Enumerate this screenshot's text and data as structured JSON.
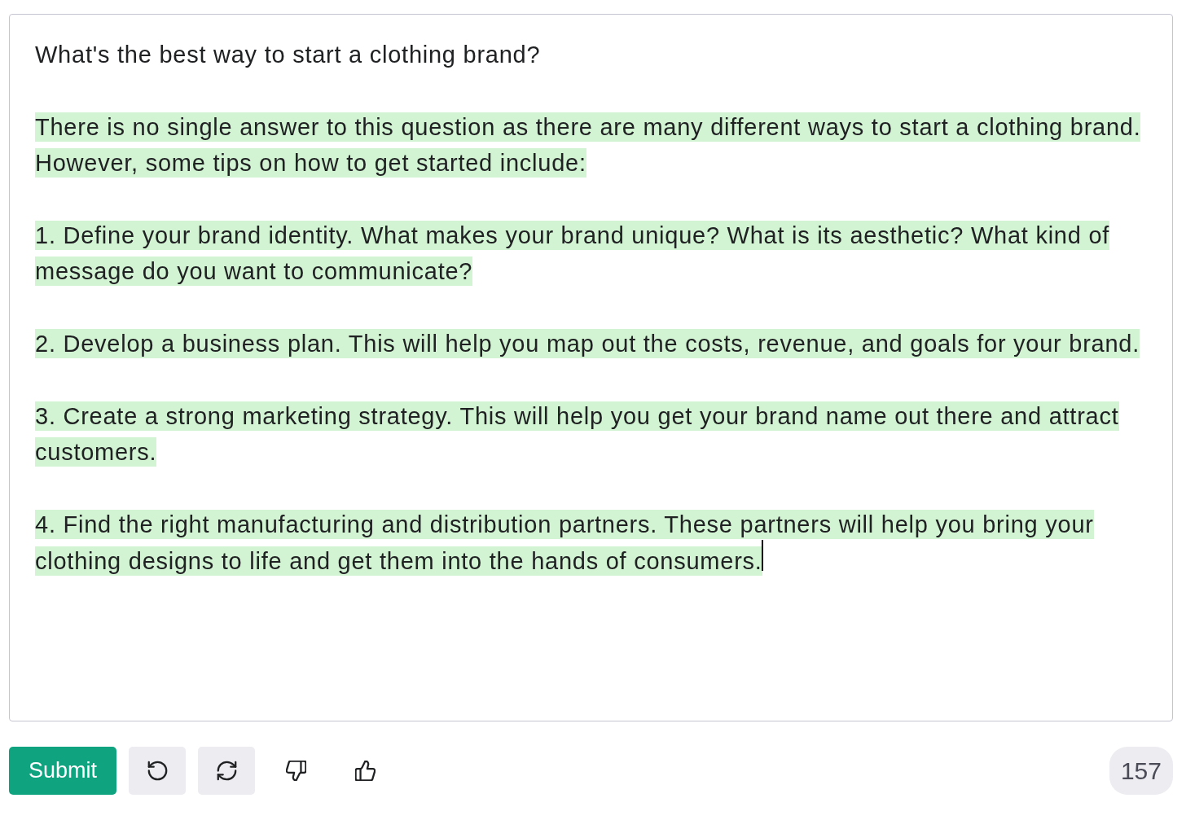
{
  "editor": {
    "paragraphs": [
      {
        "text": "What's the best way to start a clothing brand?",
        "highlighted": false
      },
      {
        "text": "There is no single answer to this question as there are many different ways to start a clothing brand. However, some tips on how to get started include:",
        "highlighted": true
      },
      {
        "text": "1. Define your brand identity. What makes your brand unique? What is its aesthetic? What kind of message do you want to communicate?",
        "highlighted": true
      },
      {
        "text": "2. Develop a business plan. This will help you map out the costs, revenue, and goals for your brand.",
        "highlighted": true
      },
      {
        "text": "3. Create a strong marketing strategy. This will help you get your brand name out there and attract customers.",
        "highlighted": true
      },
      {
        "text": "4. Find the right manufacturing and distribution partners. These partners will help you bring your clothing designs to life and get them into the hands of consumers.",
        "highlighted": true
      }
    ],
    "caret_visible": true
  },
  "toolbar": {
    "submit": "Submit",
    "icon_buttons": [
      {
        "kind": "undo"
      },
      {
        "kind": "regenerate"
      },
      {
        "kind": "thumbs_down"
      },
      {
        "kind": "thumbs_up"
      }
    ],
    "token_count": "157"
  }
}
